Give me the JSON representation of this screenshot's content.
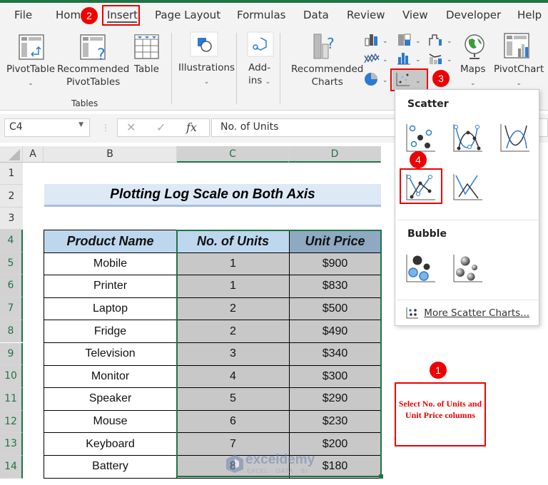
{
  "menu": {
    "tabs": [
      "File",
      "Home",
      "Insert",
      "Page Layout",
      "Formulas",
      "Data",
      "Review",
      "View",
      "Developer",
      "Help"
    ],
    "active_tab": "Insert"
  },
  "ribbon": {
    "pivottable": "PivotTable",
    "recommended_pivottables_1": "Recommended",
    "recommended_pivottables_2": "PivotTables",
    "table": "Table",
    "tables_group": "Tables",
    "illustrations": "Illustrations",
    "addins_1": "Add-",
    "addins_2": "ins",
    "recommended_charts_1": "Recommended",
    "recommended_charts_2": "Charts",
    "maps": "Maps",
    "pivotchart": "PivotChart"
  },
  "formula_bar": {
    "name_box": "C4",
    "formula": "No. of Units",
    "fx": "fx"
  },
  "columns": [
    "A",
    "B",
    "C",
    "D"
  ],
  "rows": [
    "1",
    "2",
    "3",
    "4",
    "5",
    "6",
    "7",
    "8",
    "9",
    "10",
    "11",
    "12",
    "13",
    "14"
  ],
  "sheet": {
    "title": "Plotting Log Scale on Both Axis",
    "headers": [
      "Product Name",
      "No. of Units",
      "Unit Price"
    ],
    "data": [
      [
        "Mobile",
        "1",
        "$900"
      ],
      [
        "Printer",
        "1",
        "$830"
      ],
      [
        "Laptop",
        "2",
        "$500"
      ],
      [
        "Fridge",
        "2",
        "$490"
      ],
      [
        "Television",
        "3",
        "$340"
      ],
      [
        "Monitor",
        "4",
        "$300"
      ],
      [
        "Speaker",
        "5",
        "$290"
      ],
      [
        "Mouse",
        "6",
        "$230"
      ],
      [
        "Keyboard",
        "7",
        "$200"
      ],
      [
        "Battery",
        "8",
        "$180"
      ]
    ]
  },
  "dropdown": {
    "scatter_heading": "Scatter",
    "bubble_heading": "Bubble",
    "more_link": "More Scatter Charts..."
  },
  "annotations": {
    "badge1": "1",
    "badge2": "2",
    "badge3": "3",
    "badge4": "4",
    "note": "Select No. of Units and Unit Price columns"
  },
  "watermark": {
    "name": "exceldemy",
    "tagline": "EXCEL · DATA · BI"
  },
  "colors": {
    "excel_green": "#217346",
    "annotation_red": "#ee0000",
    "header_blue": "#bdd7ee",
    "selection_gray": "#c8c8c8"
  }
}
